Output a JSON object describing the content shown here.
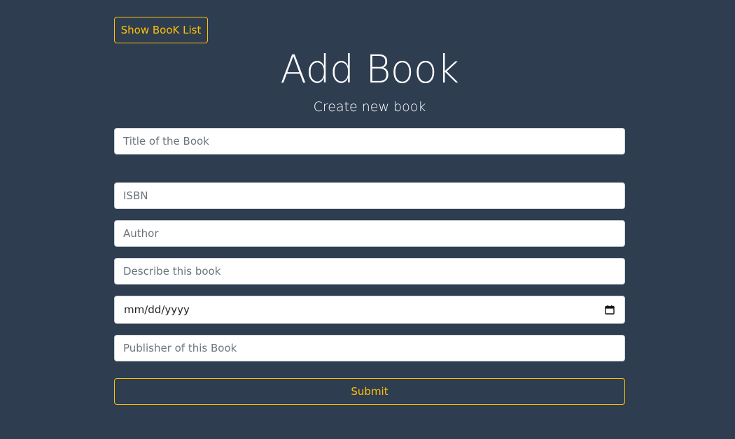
{
  "header": {
    "back_button_label": "Show BooK List",
    "title": "Add Book",
    "subtitle": "Create new book"
  },
  "form": {
    "title_placeholder": "Title of the Book",
    "title_value": "",
    "isbn_placeholder": "ISBN",
    "isbn_value": "",
    "author_placeholder": "Author",
    "author_value": "",
    "description_placeholder": "Describe this book",
    "description_value": "",
    "published_date_display": "mm/dd/yyyy",
    "publisher_placeholder": "Publisher of this Book",
    "publisher_value": "",
    "submit_label": "Submit"
  },
  "icons": {
    "date_picker": "calendar-icon"
  },
  "colors": {
    "background": "#2e3d50",
    "accent": "#ffc107",
    "text": "#ffffff",
    "input_bg": "#ffffff",
    "placeholder": "#6c757d"
  }
}
